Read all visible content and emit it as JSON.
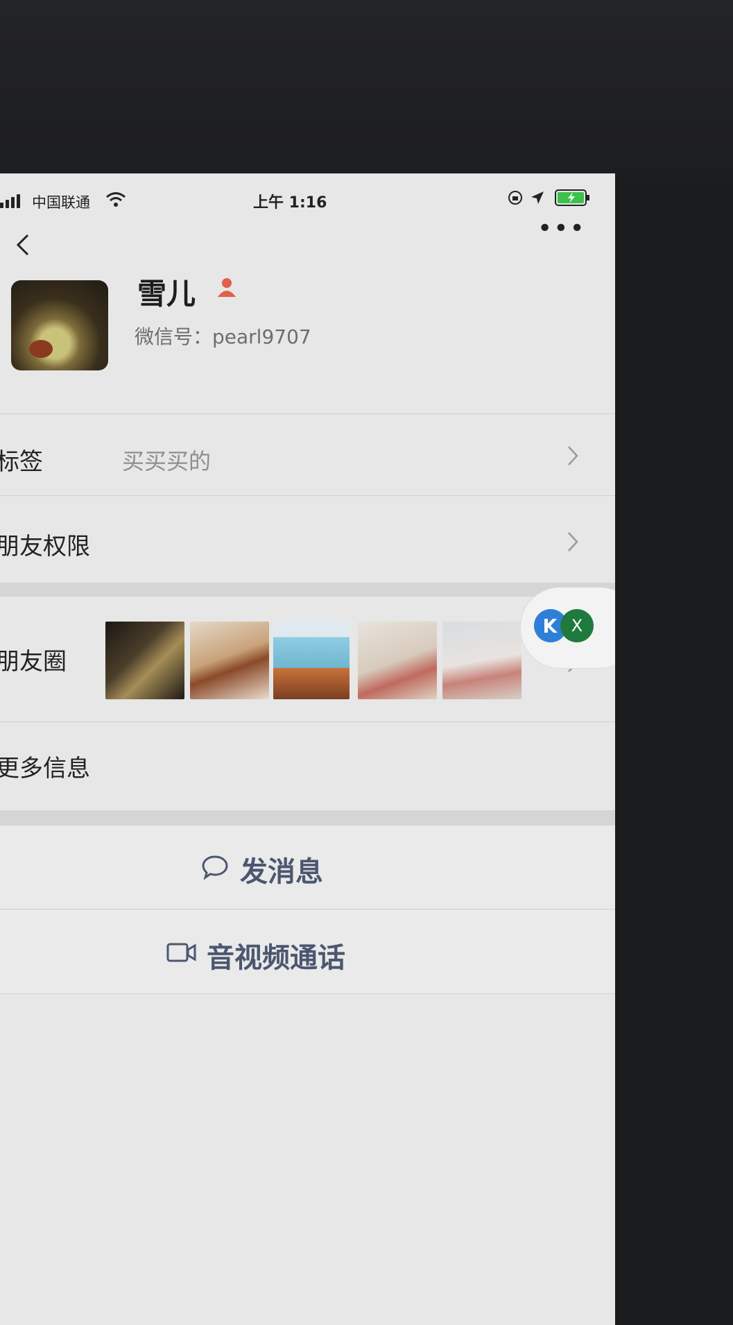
{
  "status_bar": {
    "carrier": "中国联通",
    "time": "上午 1:16"
  },
  "profile": {
    "nickname": "雪儿",
    "wechat_id": "微信号：pearl9707"
  },
  "rows": {
    "tags_label": "标签",
    "tags_value": "买买买的",
    "permissions_label": "朋友权限",
    "moments_label": "朋友圈",
    "more_info_label": "更多信息"
  },
  "floating_window": {
    "close_label": "X"
  },
  "actions": {
    "send_message": "发消息",
    "video_call": "音视频通话"
  },
  "colors": {
    "action_text": "#4c5670",
    "gender_icon": "#e0604a"
  }
}
